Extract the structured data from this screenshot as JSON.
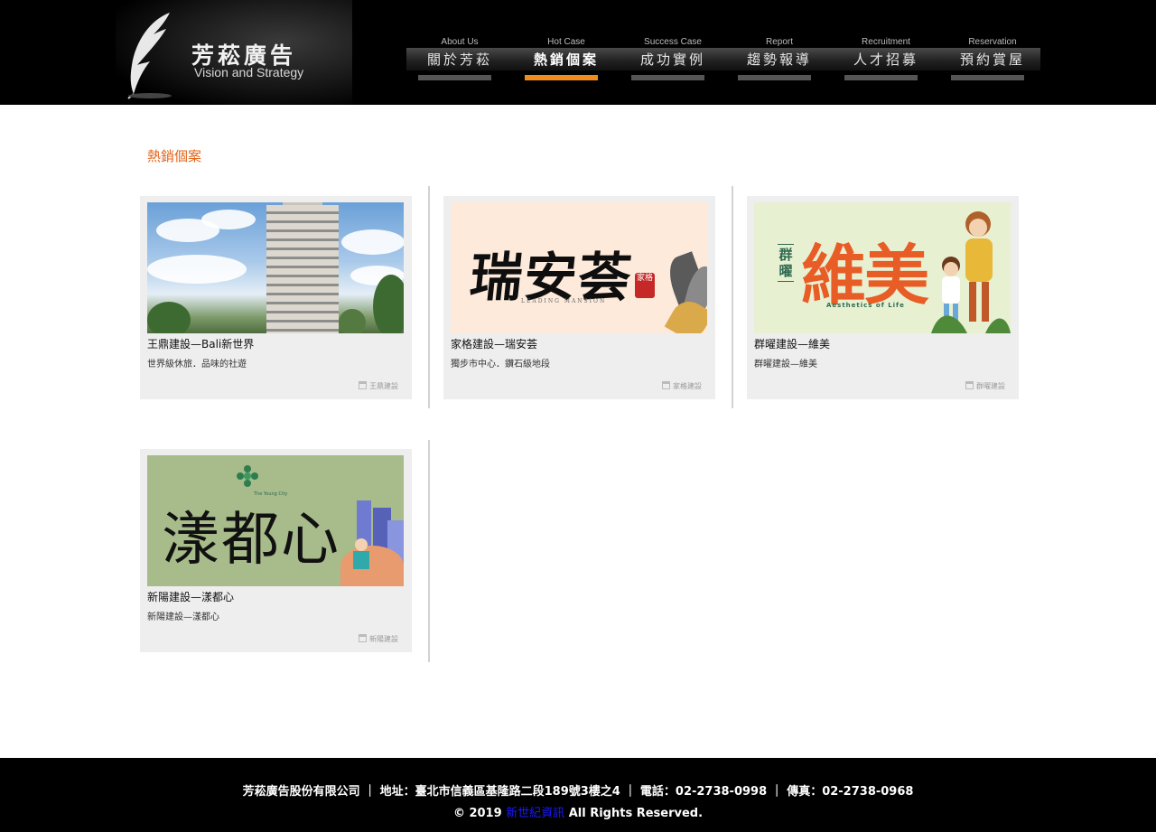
{
  "brand": {
    "name": "芳菘廣告",
    "tagline": "Vision and Strategy"
  },
  "nav": {
    "items": [
      {
        "en": "About Us",
        "zh": "關於芳菘",
        "active": false
      },
      {
        "en": "Hot Case",
        "zh": "熱銷個案",
        "active": true
      },
      {
        "en": "Success Case",
        "zh": "成功實例",
        "active": false
      },
      {
        "en": "Report",
        "zh": "趨勢報導",
        "active": false
      },
      {
        "en": "Recruitment",
        "zh": "人才招募",
        "active": false
      },
      {
        "en": "Reservation",
        "zh": "預約賞屋",
        "active": false
      }
    ]
  },
  "main": {
    "title": "熱銷個案",
    "cards": [
      {
        "title": "王鼎建設—Bali新世界",
        "desc": "世界級休旅．品味的社遊",
        "tag": "王鼎建設"
      },
      {
        "title": "家格建設—瑞安荟",
        "desc": "獨步市中心．鑽石級地段",
        "tag": "家格建設",
        "art": {
          "brush": "瑞安荟",
          "seal": "家格",
          "caption": "LEADING MANSION"
        }
      },
      {
        "title": "群曜建設—維美",
        "desc": "群曜建設—維美",
        "tag": "群曜建設",
        "art": {
          "main": "維美",
          "side": "群曜",
          "caption": "Aesthetics of Life"
        }
      },
      {
        "title": "新陽建設—漾都心",
        "desc": "新陽建設—漾都心",
        "tag": "新陽建設",
        "art": {
          "main": "漾都心",
          "caption": "The Young City"
        }
      }
    ]
  },
  "footer": {
    "line1": "芳菘廣告股份有限公司 ｜ 地址：臺北市信義區基隆路二段189號3樓之4 ｜ 電話：02-2738-0998 ｜ 傳真：02-2738-0968",
    "copyright_prefix": "© 2019 ",
    "link_text": "新世紀資訊",
    "copyright_suffix": " All Rights Reserved."
  },
  "colors": {
    "accent": "#e2651b",
    "nav_active_bar": "#f08c1e",
    "header_bg": "#000000",
    "card_bg": "#eeeeee"
  }
}
